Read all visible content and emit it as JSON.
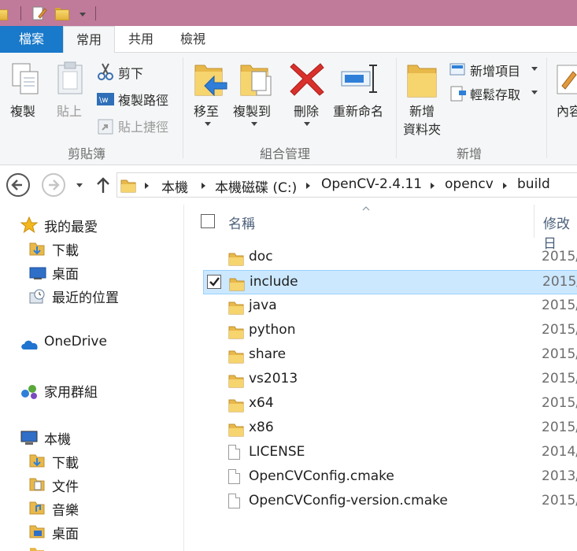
{
  "ribbon_tabs": {
    "file": "檔案",
    "home": "常用",
    "share": "共用",
    "view": "檢視"
  },
  "clipboard": {
    "copy": "複製",
    "paste": "貼上",
    "cut": "剪下",
    "copy_path": "複製路徑",
    "paste_shortcut": "貼上捷徑",
    "group": "剪貼簿"
  },
  "organize": {
    "move_to": "移至",
    "copy_to": "複製到",
    "delete": "刪除",
    "rename": "重新命名",
    "group": "組合管理"
  },
  "new": {
    "new_folder_line1": "新增",
    "new_folder_line2": "資料夾",
    "new_item": "新增項目",
    "easy_access": "輕鬆存取",
    "group": "新增"
  },
  "open": {
    "properties": "內容"
  },
  "breadcrumb": [
    "本機",
    "本機磁碟 (C:)",
    "OpenCV-2.4.11",
    "opencv",
    "build"
  ],
  "nav": {
    "favorites": "我的最愛",
    "fav_downloads": "下載",
    "fav_desktop": "桌面",
    "fav_recent": "最近的位置",
    "onedrive": "OneDrive",
    "homegroup": "家用群組",
    "this_pc": "本機",
    "pc_downloads": "下載",
    "pc_documents": "文件",
    "pc_music": "音樂",
    "pc_desktop": "桌面"
  },
  "columns": {
    "name": "名稱",
    "date": "修改日"
  },
  "files": [
    {
      "name": "doc",
      "date": "2015/",
      "type": "folder"
    },
    {
      "name": "include",
      "date": "2015/",
      "type": "folder",
      "selected": true
    },
    {
      "name": "java",
      "date": "2015/",
      "type": "folder"
    },
    {
      "name": "python",
      "date": "2015/",
      "type": "folder"
    },
    {
      "name": "share",
      "date": "2015/",
      "type": "folder"
    },
    {
      "name": "vs2013",
      "date": "2015/",
      "type": "folder"
    },
    {
      "name": "x64",
      "date": "2015/",
      "type": "folder"
    },
    {
      "name": "x86",
      "date": "2015/",
      "type": "folder"
    },
    {
      "name": "LICENSE",
      "date": "2014/",
      "type": "file"
    },
    {
      "name": "OpenCVConfig.cmake",
      "date": "2013/",
      "type": "file"
    },
    {
      "name": "OpenCVConfig-version.cmake",
      "date": "2015/",
      "type": "file"
    }
  ],
  "colors": {
    "title_bar": "#c07a9a",
    "file_tab": "#1979ca",
    "selection": "#cce8ff",
    "folder": "#e8b84a"
  }
}
